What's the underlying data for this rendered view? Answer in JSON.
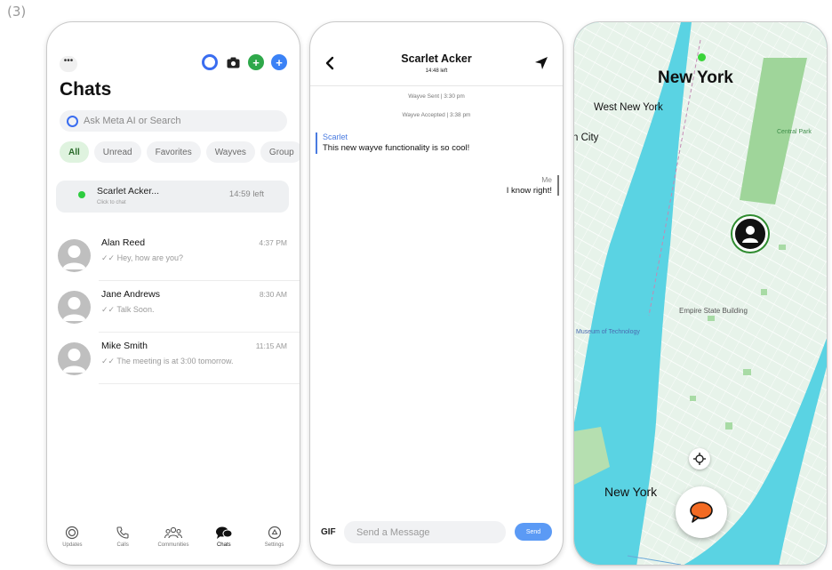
{
  "figure_label": "(3)",
  "chats_screen": {
    "title": "Chats",
    "search_placeholder": "Ask Meta AI or Search",
    "filters": [
      "All",
      "Unread",
      "Favorites",
      "Wayves",
      "Group"
    ],
    "pinned": {
      "name": "Scarlet Acker...",
      "subtitle": "Click to chat",
      "time_left": "14:59 left"
    },
    "chats": [
      {
        "name": "Alan Reed",
        "message": "Hey, how are you?",
        "time": "4:37 PM"
      },
      {
        "name": "Jane Andrews",
        "message": "Talk Soon.",
        "time": "8:30 AM"
      },
      {
        "name": "Mike Smith",
        "message": "The meeting is at 3:00 tomorrow.",
        "time": "11:15 AM"
      }
    ],
    "tabs": [
      {
        "label": "Updates",
        "icon": "updates-icon"
      },
      {
        "label": "Calls",
        "icon": "phone-icon"
      },
      {
        "label": "Communities",
        "icon": "communities-icon"
      },
      {
        "label": "Chats",
        "icon": "chat-bubbles-icon",
        "active": true
      },
      {
        "label": "Settings",
        "icon": "settings-icon"
      }
    ],
    "colors": {
      "accent_green": "#2ea84a",
      "accent_blue": "#3b82f6",
      "meta_ring": "#3a6df0"
    }
  },
  "conversation_screen": {
    "contact_name": "Scarlet Acker",
    "time_left": "14:48 left",
    "system_messages": [
      "Wayve Sent | 3:30 pm",
      "Wayve Accepted | 3:38 pm"
    ],
    "messages": [
      {
        "sender": "Scarlet",
        "text": "This new wayve functionality is so cool!"
      },
      {
        "sender": "Me",
        "text": "I know right!"
      }
    ],
    "gif_label": "GIF",
    "input_placeholder": "Send a Message",
    "send_label": "Send",
    "colors": {
      "sender_them": "#4a7be0",
      "send_button": "#5b9af5"
    }
  },
  "map_screen": {
    "labels": {
      "city_top": "New York",
      "west_new_york": "West New York",
      "city_fragment": "n City",
      "central_park": "Central Park",
      "empire_state": "Empire State Building",
      "museum_fragment": "Museum of Technology",
      "city_bottom": "New York"
    },
    "colors": {
      "water": "#5ad3e3",
      "land": "#e6f3ea",
      "park": "#9fd59a",
      "street": "#ffffff"
    }
  }
}
